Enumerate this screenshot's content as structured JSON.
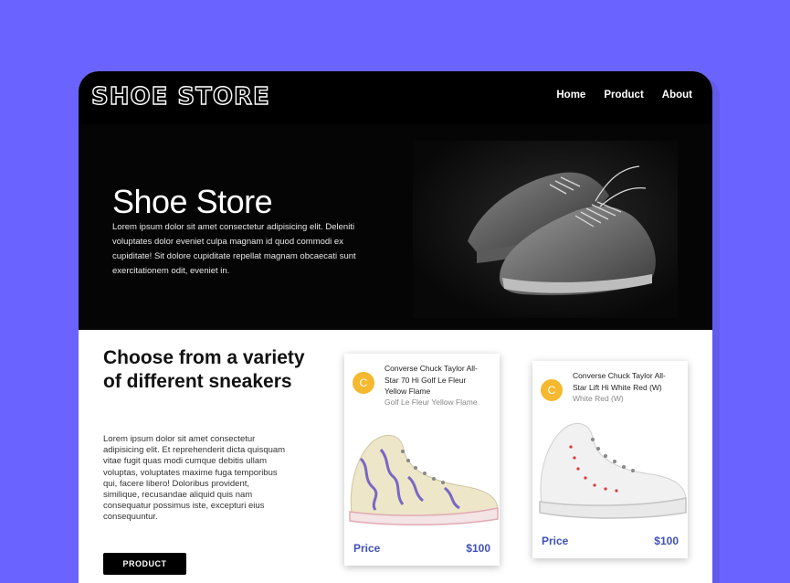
{
  "header": {
    "logo": "SHOE STORE",
    "nav": [
      "Home",
      "Product",
      "About"
    ]
  },
  "hero": {
    "title": "Shoe Store",
    "text": "Lorem ipsum dolor sit amet consectetur adipisicing elit. Deleniti voluptates dolor eveniet culpa magnam id quod commodi ex cupiditate! Sit dolore cupiditate repellat magnam obcaecati sunt exercitationem odit, eveniet in."
  },
  "section": {
    "title": "Choose from a variety of different sneakers",
    "text": "Lorem ipsum dolor sit amet consectetur adipisicing elit. Et reprehenderit dicta quisquam vitae fugit quas modi cumque debitis ullam voluptas, voluptates maxime fuga temporibus qui, facere libero! Doloribus provident, similique, recusandae aliquid quis nam consequatur possimus iste, excepturi eius consequuntur.",
    "button": "PRODUCT"
  },
  "products": [
    {
      "avatar": "C",
      "title": "Converse Chuck Taylor All-Star 70 Hi Golf Le Fleur Yellow Flame",
      "subtitle": "Golf Le Fleur Yellow Flame",
      "price_label": "Price",
      "price": "$100"
    },
    {
      "avatar": "C",
      "title": "Converse Chuck Taylor All-Star Lift Hi White Red (W)",
      "subtitle": "White Red (W)",
      "price_label": "Price",
      "price": "$100"
    }
  ],
  "colors": {
    "background": "#6b63ff",
    "avatar": "#f5b82e",
    "price": "#3f51b5"
  }
}
